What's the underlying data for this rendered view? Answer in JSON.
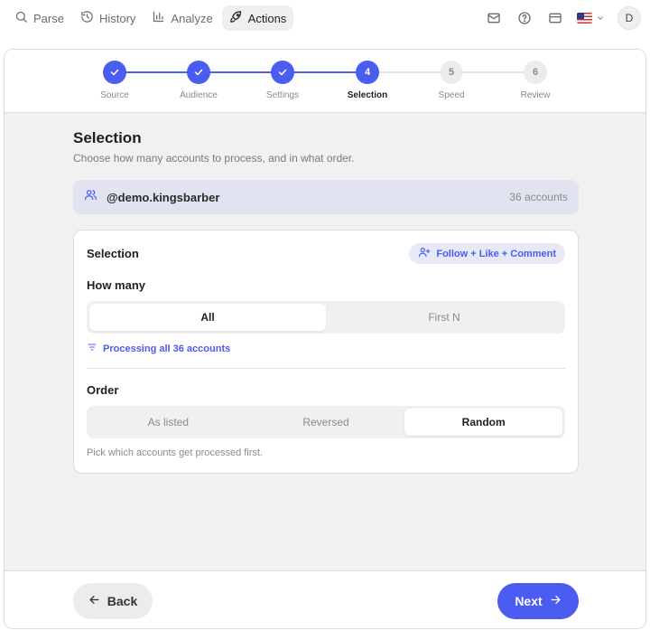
{
  "nav": {
    "items": [
      {
        "label": "Parse",
        "icon": "search-icon",
        "active": false
      },
      {
        "label": "History",
        "icon": "history-icon",
        "active": false
      },
      {
        "label": "Analyze",
        "icon": "bar-chart-icon",
        "active": false
      },
      {
        "label": "Actions",
        "icon": "rocket-icon",
        "active": true
      }
    ],
    "right_icons": [
      "mail-icon",
      "help-icon",
      "card-icon",
      "us-flag-icon",
      "chevron-down-icon"
    ],
    "avatar_initial": "D"
  },
  "stepper": {
    "steps": [
      {
        "number": "1",
        "label": "Source",
        "state": "done"
      },
      {
        "number": "2",
        "label": "Audience",
        "state": "done"
      },
      {
        "number": "3",
        "label": "Settings",
        "state": "done"
      },
      {
        "number": "4",
        "label": "Selection",
        "state": "current"
      },
      {
        "number": "5",
        "label": "Speed",
        "state": "todo"
      },
      {
        "number": "6",
        "label": "Review",
        "state": "todo"
      }
    ]
  },
  "page": {
    "title": "Selection",
    "subtitle": "Choose how many accounts to process, and in what order."
  },
  "account": {
    "name": "@demo.kingsbarber",
    "count": "36 accounts"
  },
  "panel": {
    "title": "Selection",
    "action_badge": "Follow + Like + Comment",
    "how_many": {
      "label": "How many",
      "options": [
        "All",
        "First N"
      ],
      "selected": "All",
      "info": "Processing all 36 accounts"
    },
    "order": {
      "label": "Order",
      "options": [
        "As listed",
        "Reversed",
        "Random"
      ],
      "selected": "Random",
      "hint": "Pick which accounts get processed first."
    }
  },
  "footer": {
    "back_label": "Back",
    "next_label": "Next"
  },
  "colors": {
    "accent": "#4b5cf0",
    "background": "#f1f1f1",
    "account_bar": "#e1e3f0"
  }
}
